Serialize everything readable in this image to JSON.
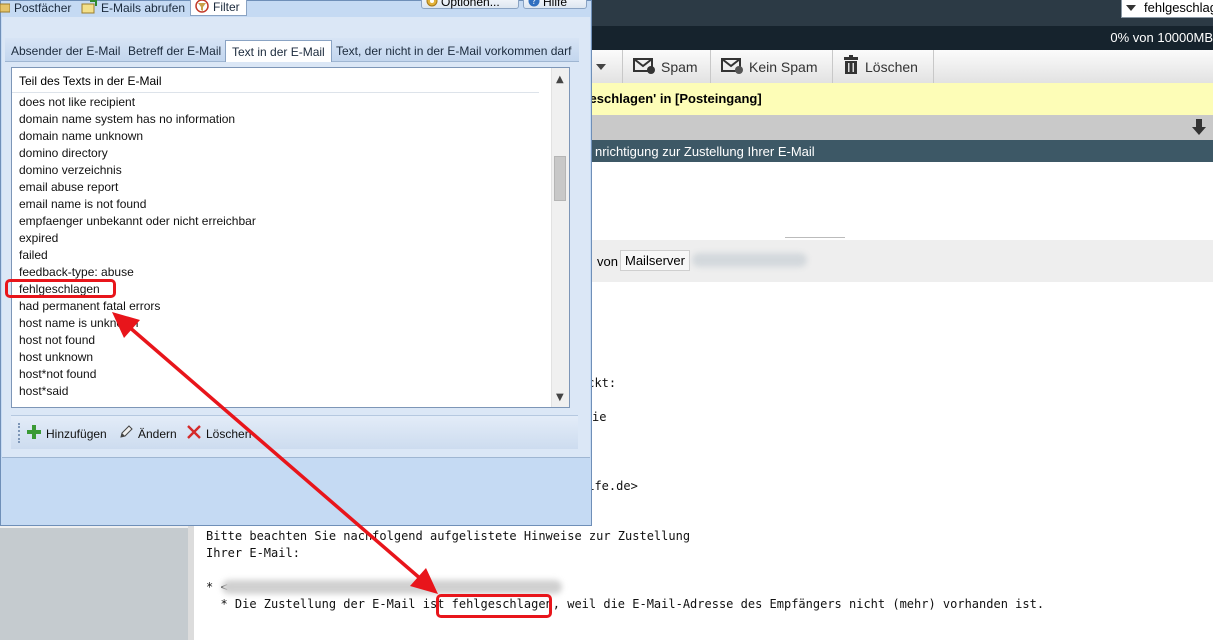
{
  "background": {
    "search_value": "fehlgeschlagen",
    "quota_text": "0% von 10000MB",
    "toolbar": {
      "spam_label": "Spam",
      "no_spam_label": "Kein Spam",
      "delete_label": "Löschen"
    },
    "notice_text": "lgeschlagen' in [Posteingang]",
    "subject_text": "nrichtigung zur Zustellung Ihrer E-Mail",
    "from_label": "von",
    "from_server": "Mailserver",
    "body_lines": [
      "ickt:",
      "ie",
      "life.de>",
      "Bitte beachten Sie nachfolgend aufgelistete Hinweise zur Zustellung",
      "Ihrer E-Mail:",
      "* <",
      "  * Die Zustellung der E-Mail ist fehlgeschlagen, weil die E-Mail-Adresse des Empfängers nicht (mehr) vorhanden ist."
    ]
  },
  "dialog": {
    "top_buttons": {
      "options_label": "Optionen...",
      "help_label": "Hilfe"
    },
    "main_tabs": [
      {
        "label": "Postfächer"
      },
      {
        "label": "E-Mails abrufen"
      },
      {
        "label": "Filter"
      }
    ],
    "sub_tabs": [
      {
        "label": "Absender der E-Mail"
      },
      {
        "label": "Betreff der E-Mail"
      },
      {
        "label": "Text in der E-Mail"
      },
      {
        "label": "Text, der nicht in der E-Mail vorkommen darf"
      }
    ],
    "list_header": "Teil des Texts in der E-Mail",
    "list_items": [
      "does not like recipient",
      "domain name system has no information",
      "domain name unknown",
      "domino directory",
      "domino verzeichnis",
      "email abuse report",
      "email name is not found",
      "empfaenger unbekannt oder nicht erreichbar",
      "expired",
      "failed",
      "feedback-type: abuse",
      "fehlgeschlagen",
      "had permanent fatal errors",
      "host name is unknown",
      "host not found",
      "host unknown",
      "host*not found",
      "host*said"
    ],
    "actions": {
      "add_label": "Hinzufügen",
      "edit_label": "Ändern",
      "delete_label": "Löschen"
    }
  },
  "colors": {
    "annotation": "#e8151b",
    "dialog_bg": "#c5daf3",
    "notice_bg": "#fdfdb7",
    "subject_bg": "#3d5866"
  }
}
